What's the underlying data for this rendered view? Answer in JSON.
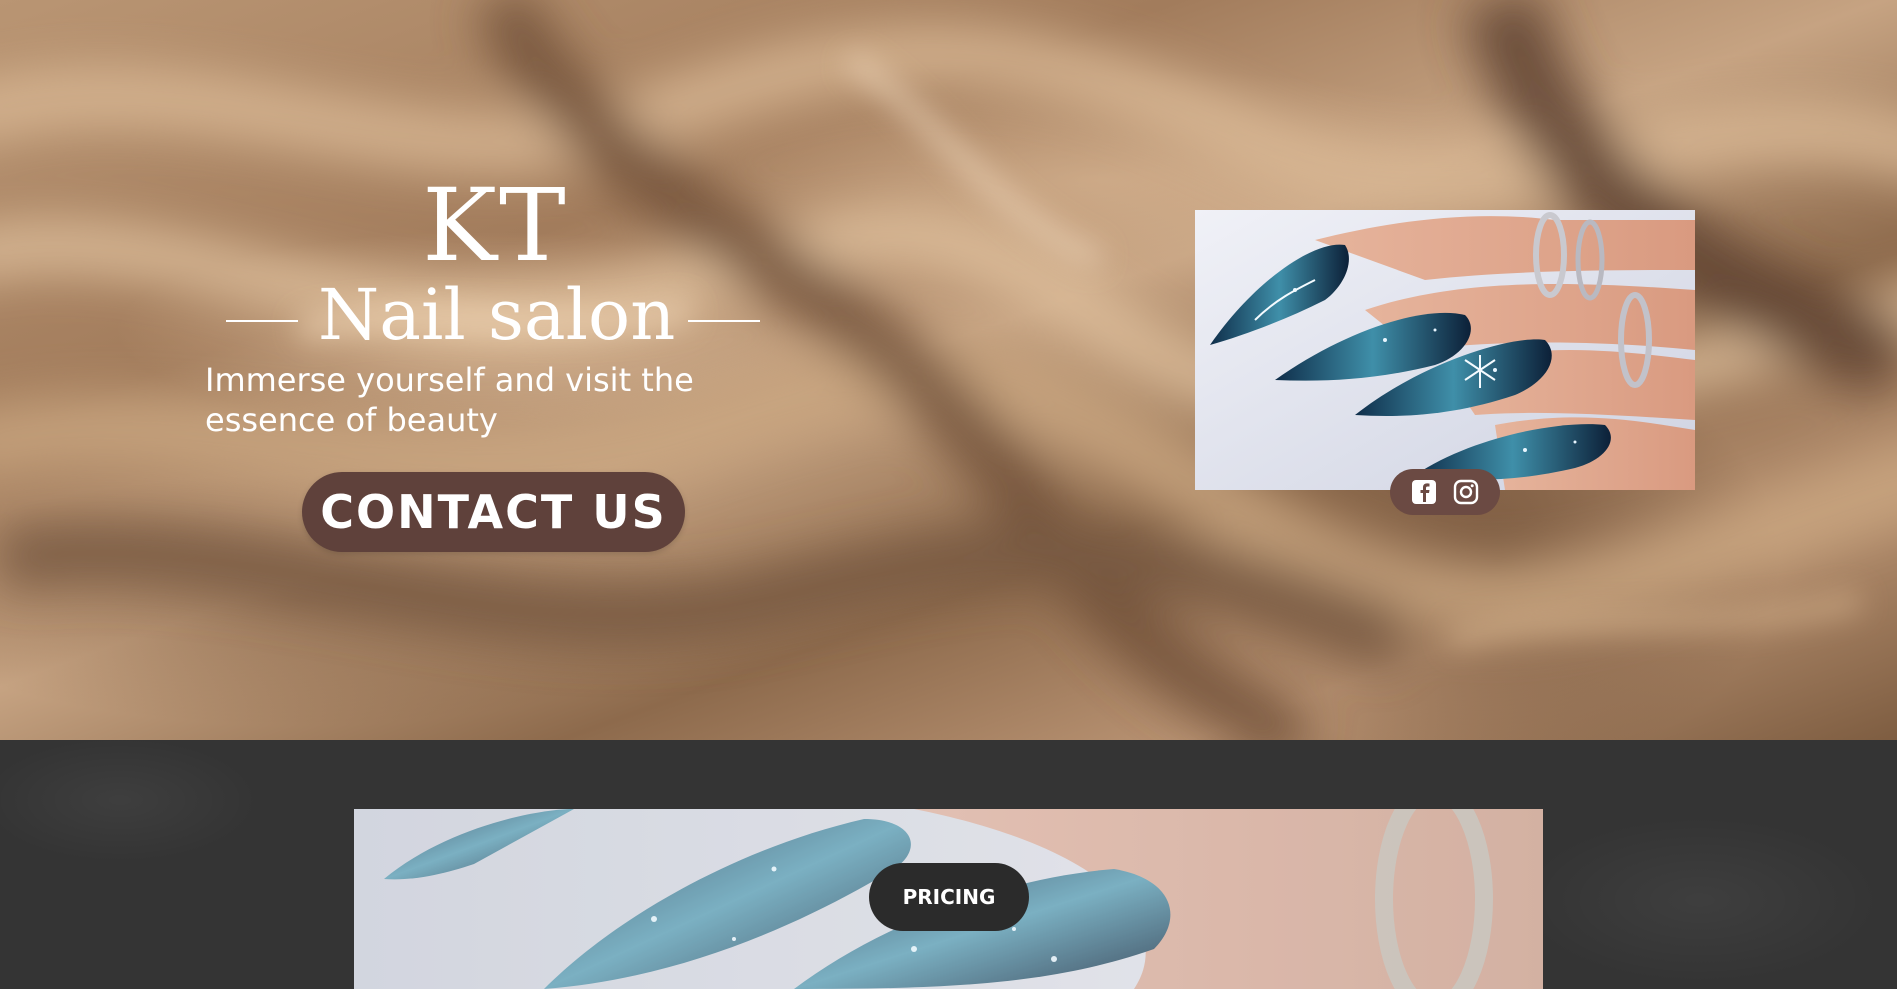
{
  "hero": {
    "brand_title": "KT",
    "brand_subtitle": "Nail salon",
    "tagline_line1": "Immerse yourself and visit the",
    "tagline_line2": "essence of beauty",
    "contact_label": "CONTACT US",
    "background_image": "beige-satin-fabric",
    "photo": "blue-stiletto-nails-with-snowflake-art"
  },
  "social": {
    "icons": [
      "facebook-icon",
      "instagram-icon"
    ]
  },
  "section2": {
    "pricing_label": "PRICING",
    "photo": "blue-stiletto-nails-closeup"
  },
  "colors": {
    "contact_button": "#5f413b",
    "social_pill": "#6b4a43",
    "lower_background": "#343434",
    "pricing_button": "#2b2b2b",
    "text": "#ffffff"
  }
}
